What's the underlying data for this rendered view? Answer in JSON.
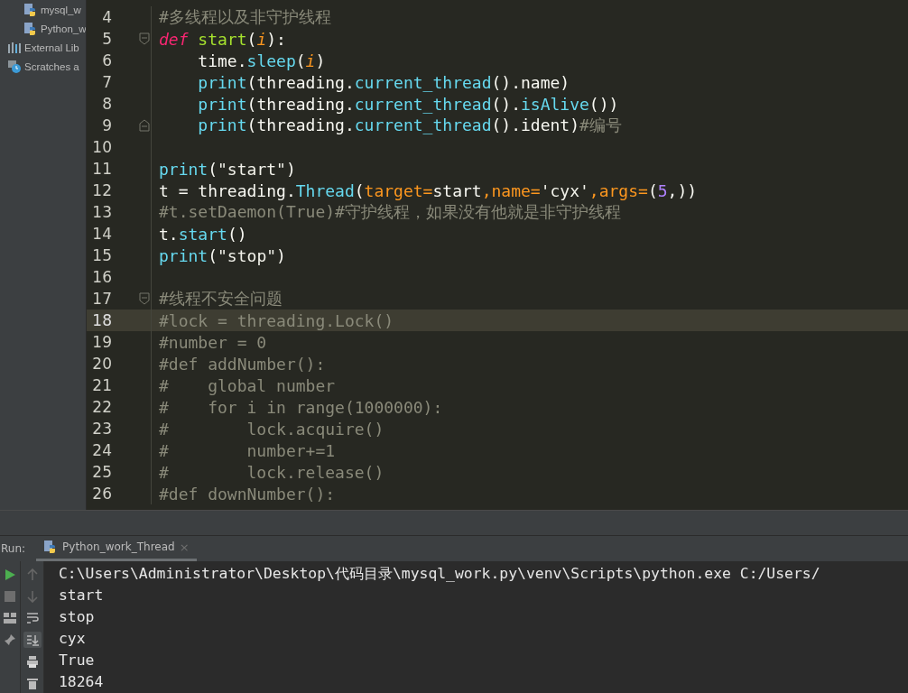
{
  "sidebar": {
    "items": [
      {
        "kind": "python-file",
        "label": "mysql_w"
      },
      {
        "kind": "python-file",
        "label": "Python_w"
      },
      {
        "kind": "library",
        "label": "External Lib"
      },
      {
        "kind": "scratches",
        "label": "Scratches a"
      }
    ]
  },
  "editor": {
    "lines": [
      {
        "number": "4",
        "current": false,
        "fold_start": false,
        "fold_end": false,
        "tokens": [
          {
            "kind": "comment",
            "t": "#多线程以及非守护线程"
          }
        ]
      },
      {
        "number": "5",
        "current": false,
        "fold_start": true,
        "fold_end": false,
        "tokens": [
          {
            "kind": "keyword",
            "t": "def"
          },
          {
            "kind": "function",
            "t": " start"
          },
          {
            "kind": "plain",
            "t": "("
          },
          {
            "kind": "param",
            "t": "i"
          },
          {
            "kind": "plain",
            "t": "):"
          }
        ]
      },
      {
        "number": "6",
        "current": false,
        "fold_start": false,
        "fold_end": false,
        "tokens": [
          {
            "kind": "plain",
            "t": "    time."
          },
          {
            "kind": "call",
            "t": "sleep"
          },
          {
            "kind": "plain",
            "t": "("
          },
          {
            "kind": "param",
            "t": "i"
          },
          {
            "kind": "plain",
            "t": ")"
          }
        ]
      },
      {
        "number": "7",
        "current": false,
        "fold_start": false,
        "fold_end": false,
        "tokens": [
          {
            "kind": "call",
            "t": "    print"
          },
          {
            "kind": "plain",
            "t": "(threading."
          },
          {
            "kind": "call",
            "t": "current_thread"
          },
          {
            "kind": "plain",
            "t": "().name)"
          }
        ]
      },
      {
        "number": "8",
        "current": false,
        "fold_start": false,
        "fold_end": false,
        "tokens": [
          {
            "kind": "call",
            "t": "    print"
          },
          {
            "kind": "plain",
            "t": "(threading."
          },
          {
            "kind": "call",
            "t": "current_thread"
          },
          {
            "kind": "plain",
            "t": "()."
          },
          {
            "kind": "call",
            "t": "isAlive"
          },
          {
            "kind": "plain",
            "t": "())"
          }
        ]
      },
      {
        "number": "9",
        "current": false,
        "fold_start": false,
        "fold_end": true,
        "tokens": [
          {
            "kind": "call",
            "t": "    print"
          },
          {
            "kind": "plain",
            "t": "(threading."
          },
          {
            "kind": "call",
            "t": "current_thread"
          },
          {
            "kind": "plain",
            "t": "().ident)"
          },
          {
            "kind": "comment",
            "t": "#编号"
          }
        ]
      },
      {
        "number": "10",
        "current": false,
        "fold_start": false,
        "fold_end": false
      },
      {
        "number": "11",
        "current": false,
        "fold_start": false,
        "fold_end": false,
        "tokens": [
          {
            "kind": "call",
            "t": "print"
          },
          {
            "kind": "plain",
            "t": "("
          },
          {
            "kind": "string",
            "t": "\"start\""
          },
          {
            "kind": "plain",
            "t": ")"
          }
        ]
      },
      {
        "number": "12",
        "current": false,
        "fold_start": false,
        "fold_end": false,
        "tokens": [
          {
            "kind": "plain",
            "t": "t = threading."
          },
          {
            "kind": "call",
            "t": "Thread"
          },
          {
            "kind": "plain",
            "t": "("
          },
          {
            "kind": "kwarg",
            "t": "target="
          },
          {
            "kind": "plain",
            "t": "start"
          },
          {
            "kind": "kwarg",
            "t": ",name="
          },
          {
            "kind": "string",
            "t": "'cyx'"
          },
          {
            "kind": "kwarg",
            "t": ",args="
          },
          {
            "kind": "plain",
            "t": "("
          },
          {
            "kind": "number",
            "t": "5"
          },
          {
            "kind": "plain",
            "t": ",))"
          }
        ]
      },
      {
        "number": "13",
        "current": false,
        "fold_start": false,
        "fold_end": false,
        "tokens": [
          {
            "kind": "comment",
            "t": "#t.setDaemon(True)#守护线程，如果没有他就是非守护线程"
          }
        ]
      },
      {
        "number": "14",
        "current": false,
        "fold_start": false,
        "fold_end": false,
        "tokens": [
          {
            "kind": "plain",
            "t": "t."
          },
          {
            "kind": "call",
            "t": "start"
          },
          {
            "kind": "plain",
            "t": "()"
          }
        ]
      },
      {
        "number": "15",
        "current": false,
        "fold_start": false,
        "fold_end": false,
        "tokens": [
          {
            "kind": "call",
            "t": "print"
          },
          {
            "kind": "plain",
            "t": "("
          },
          {
            "kind": "string",
            "t": "\"stop\""
          },
          {
            "kind": "plain",
            "t": ")"
          }
        ]
      },
      {
        "number": "16",
        "current": false,
        "fold_start": false,
        "fold_end": false
      },
      {
        "number": "17",
        "current": false,
        "fold_start": true,
        "fold_end": false,
        "tokens": [
          {
            "kind": "comment",
            "t": "#线程不安全问题"
          }
        ]
      },
      {
        "number": "18",
        "current": true,
        "fold_start": false,
        "fold_end": false,
        "tokens": [
          {
            "kind": "comment",
            "t": "#lock = threading.Lock()"
          }
        ]
      },
      {
        "number": "19",
        "current": false,
        "fold_start": false,
        "fold_end": false,
        "tokens": [
          {
            "kind": "comment",
            "t": "#number = 0"
          }
        ]
      },
      {
        "number": "20",
        "current": false,
        "fold_start": false,
        "fold_end": false,
        "tokens": [
          {
            "kind": "comment",
            "t": "#def addNumber():"
          }
        ]
      },
      {
        "number": "21",
        "current": false,
        "fold_start": false,
        "fold_end": false,
        "tokens": [
          {
            "kind": "comment",
            "t": "#    global number"
          }
        ]
      },
      {
        "number": "22",
        "current": false,
        "fold_start": false,
        "fold_end": false,
        "tokens": [
          {
            "kind": "comment",
            "t": "#    for i in range(1000000):"
          }
        ]
      },
      {
        "number": "23",
        "current": false,
        "fold_start": false,
        "fold_end": false,
        "tokens": [
          {
            "kind": "comment",
            "t": "#        lock.acquire()"
          }
        ]
      },
      {
        "number": "24",
        "current": false,
        "fold_start": false,
        "fold_end": false,
        "tokens": [
          {
            "kind": "comment",
            "t": "#        number+=1"
          }
        ]
      },
      {
        "number": "25",
        "current": false,
        "fold_start": false,
        "fold_end": false,
        "tokens": [
          {
            "kind": "comment",
            "t": "#        lock.release()"
          }
        ]
      },
      {
        "number": "26",
        "current": false,
        "fold_start": false,
        "fold_end": false,
        "tokens": [
          {
            "kind": "comment",
            "t": "#def downNumber():"
          }
        ]
      }
    ]
  },
  "run_panel": {
    "label": "Run:",
    "tabs": [
      {
        "label": "Python_work_Thread",
        "selected": true,
        "close": "×"
      }
    ],
    "console": [
      "C:\\Users\\Administrator\\Desktop\\代码目录\\mysql_work.py\\venv\\Scripts\\python.exe C:/Users/",
      "start",
      "stop",
      "cyx",
      "True",
      "18264"
    ]
  }
}
